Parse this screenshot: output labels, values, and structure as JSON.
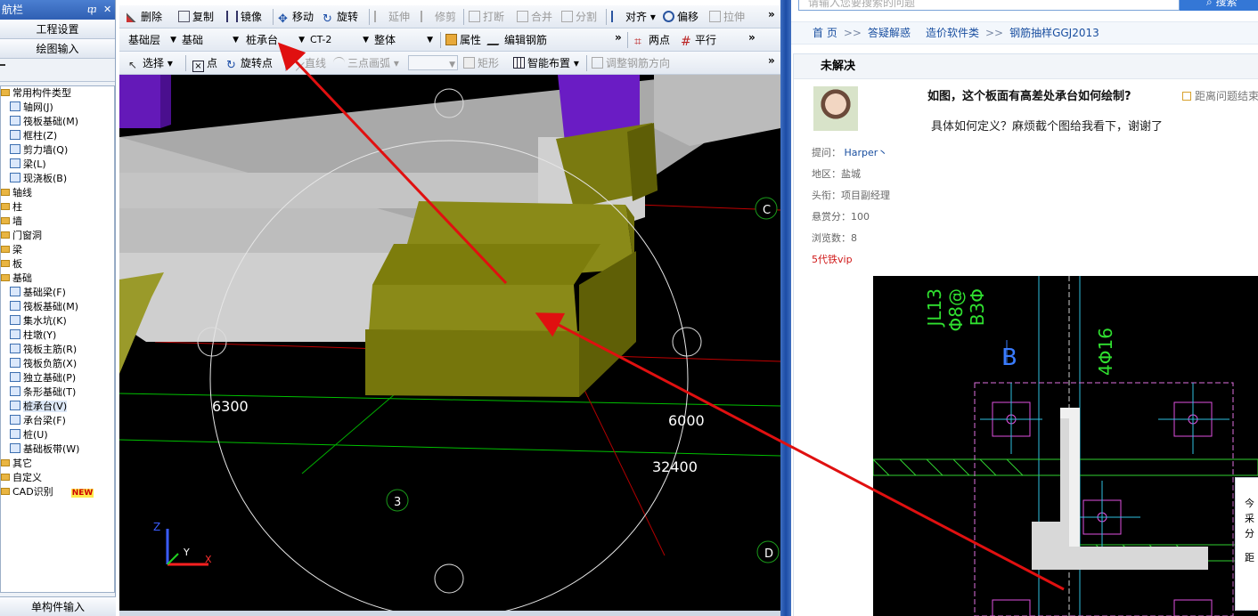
{
  "left_panel": {
    "title": "航栏",
    "pin_label": "ⴔ",
    "close_label": "✕",
    "buttons": [
      "工程设置",
      "绘图输入"
    ],
    "tree": [
      {
        "label": "常用构件类型",
        "kind": "folder",
        "indent": 0
      },
      {
        "label": "轴网(J)",
        "kind": "item",
        "indent": 1
      },
      {
        "label": "筏板基础(M)",
        "kind": "item",
        "indent": 1
      },
      {
        "label": "框柱(Z)",
        "kind": "item",
        "indent": 1
      },
      {
        "label": "剪力墙(Q)",
        "kind": "item",
        "indent": 1
      },
      {
        "label": "梁(L)",
        "kind": "item",
        "indent": 1
      },
      {
        "label": "现浇板(B)",
        "kind": "item",
        "indent": 1
      },
      {
        "label": "轴线",
        "kind": "folder",
        "indent": 0
      },
      {
        "label": "柱",
        "kind": "folder",
        "indent": 0
      },
      {
        "label": "墙",
        "kind": "folder",
        "indent": 0
      },
      {
        "label": "门窗洞",
        "kind": "folder",
        "indent": 0
      },
      {
        "label": "梁",
        "kind": "folder",
        "indent": 0
      },
      {
        "label": "板",
        "kind": "folder",
        "indent": 0
      },
      {
        "label": "基础",
        "kind": "folder",
        "indent": 0
      },
      {
        "label": "基础梁(F)",
        "kind": "item",
        "indent": 1
      },
      {
        "label": "筏板基础(M)",
        "kind": "item",
        "indent": 1
      },
      {
        "label": "集水坑(K)",
        "kind": "item",
        "indent": 1
      },
      {
        "label": "柱墩(Y)",
        "kind": "item",
        "indent": 1
      },
      {
        "label": "筏板主筋(R)",
        "kind": "item",
        "indent": 1
      },
      {
        "label": "筏板负筋(X)",
        "kind": "item",
        "indent": 1
      },
      {
        "label": "独立基础(P)",
        "kind": "item",
        "indent": 1
      },
      {
        "label": "条形基础(T)",
        "kind": "item",
        "indent": 1
      },
      {
        "label": "桩承台(V)",
        "kind": "item",
        "indent": 1,
        "selected": true
      },
      {
        "label": "承台梁(F)",
        "kind": "item",
        "indent": 1
      },
      {
        "label": "桩(U)",
        "kind": "item",
        "indent": 1
      },
      {
        "label": "基础板带(W)",
        "kind": "item",
        "indent": 1
      },
      {
        "label": "其它",
        "kind": "folder",
        "indent": 0
      },
      {
        "label": "自定义",
        "kind": "folder",
        "indent": 0
      },
      {
        "label": "CAD识别",
        "kind": "folder",
        "indent": 0,
        "badge": "NEW"
      }
    ],
    "bottom_button": "单构件输入"
  },
  "toolbar1": {
    "items": [
      "删除",
      "复制",
      "镜像",
      "移动",
      "旋转",
      "延伸",
      "修剪",
      "打断",
      "合并",
      "分割",
      "对齐",
      "偏移",
      "拉伸"
    ],
    "disabled": [
      "延伸",
      "修剪",
      "打断",
      "合并",
      "分割",
      "拉伸"
    ]
  },
  "toolbar2": {
    "floor": "基础层",
    "category": "基础",
    "type": "桩承台",
    "name": "CT-2",
    "mode": "整体",
    "property_button": "属性",
    "edit_rebar_button": "编辑钢筋",
    "two_point_button": "两点",
    "parallel_button": "平行"
  },
  "toolbar3": {
    "select_button": "选择",
    "point_button": "点",
    "rotate_point_button": "旋转点",
    "line_button": "直线",
    "arc_button": "三点画弧",
    "rect_button": "矩形",
    "smart_layout_button": "智能布置",
    "adjust_rebar_button": "调整钢筋方向"
  },
  "viewport": {
    "dims": [
      "6300",
      "6000",
      "32400"
    ],
    "axis_labels": [
      "C",
      "3",
      "D"
    ],
    "triad": [
      "Z",
      "Y",
      "X"
    ]
  },
  "browser": {
    "search_placeholder": "请输入您要搜索的问题",
    "search_button": "搜索",
    "breadcrumb": [
      "首 页",
      "答疑解惑",
      "造价软件类",
      "钢筋抽样GGJ2013"
    ],
    "status": "未解决",
    "question_title": "如图，这个板面有高差处承台如何绘制?",
    "distance_text": "距离问题结束",
    "question_body": "具体如何定义？麻烦截个图给我看下，谢谢了",
    "meta": {
      "asker_label": "提问：",
      "asker": "Harper丶",
      "region": "地区：盐城",
      "title": "头衔：项目副经理",
      "reward": "悬赏分：100",
      "views": "浏览数：8"
    },
    "vip": "5代铁vip",
    "popup_lines": [
      "今",
      "采",
      "分",
      "距"
    ]
  },
  "cad": {
    "labels": [
      "JL13",
      "Φ8@",
      "B3Φ",
      "B",
      "4Φ16"
    ]
  }
}
